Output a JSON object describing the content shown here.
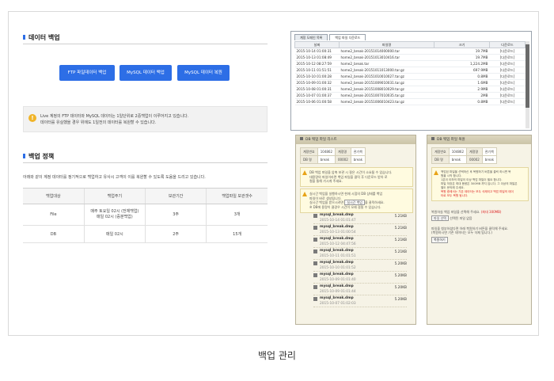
{
  "caption": "백업 관리",
  "left": {
    "section1_title": "데이터 백업",
    "buttons": [
      "FTP 파일데이터 백업",
      "MySQL 데이터 백업",
      "MySQL 데이터 복원"
    ],
    "notice_lines": [
      "Live 계정의 FTP 데이터와 MySQL 데이터는 1일단위로 2중백업이 이루어지고 있습니다.",
      "데이터를 유실했을 경우 위에도 1일전의 데이터를 복원할 수 있습니다."
    ],
    "section2_title": "백업 정책",
    "policy_desc": "아래와 같이 계정 데이터를 정기적으로 백업하고 유사시 고객이 이를 복원할 수 있도록 도움을 드리고 있습니다.",
    "policy_headers": [
      "백업대상",
      "백업주기",
      "보관기간",
      "백업파일 보관갯수"
    ],
    "policy_rows": [
      {
        "target": "File",
        "cycle1": "매주 토요일 02시 (전체백업)",
        "cycle2": "매일 02시 (증분백업)",
        "period": "3주",
        "count": "3개"
      },
      {
        "target": "DB",
        "cycle1": "매일 02시",
        "cycle2": "",
        "period": "2주",
        "count": "15개"
      }
    ]
  },
  "ss1": {
    "tabs": [
      "계정 도메인 목록",
      "백업 파일 다운로드"
    ],
    "headers": [
      "날짜",
      "파일명",
      "크기",
      "다운로드"
    ],
    "rows": [
      {
        "date": "2015-10-14 01:00:31",
        "name": "home2_break-20151014000000.tar",
        "size": "19.7MB",
        "dl": "[다운로드]"
      },
      {
        "date": "2015-10-13 01:08:49",
        "name": "home2_break-20151013010416.tar",
        "size": "19.7MB",
        "dl": "[다운로드]"
      },
      {
        "date": "2015-10-12 08:27:59",
        "name": "home2_break.tar",
        "size": "1,224.2MB",
        "dl": "[다운로드]"
      },
      {
        "date": "2015-10-11 01:51:51",
        "name": "home2_break-20151011013000.tar.gz",
        "size": "697.9MB",
        "dl": "[다운로드]"
      },
      {
        "date": "2015-10-10 01:00:28",
        "name": "home2_break-20151010010027.tar.gz",
        "size": "0.8MB",
        "dl": "[다운로드]"
      },
      {
        "date": "2015-10-09 01:00:32",
        "name": "home2_break-20151009010031.tar.gz",
        "size": "1.6MB",
        "dl": "[다운로드]"
      },
      {
        "date": "2015-10-08 01:00:31",
        "name": "home2_break-20151008010029.tar.gz",
        "size": "2.9MB",
        "dl": "[다운로드]"
      },
      {
        "date": "2015-10-07 01:00:37",
        "name": "home2_break-20151007010035.tar.gz",
        "size": "2MB",
        "dl": "[다운로드]"
      },
      {
        "date": "2015-10-06 01:00:58",
        "name": "home2_break-20151006010423.tar.gz",
        "size": "0.8MB",
        "dl": "[다운로드]"
      }
    ]
  },
  "ss2": {
    "title": "DB 백업 파일 리스트",
    "info": {
      "k1": "계정번호",
      "v1": "104862",
      "k2": "계정명",
      "v2": "관기책",
      "k3": "DB 명",
      "v3": "break",
      "k4": "파일명",
      "v4": "00002",
      "v5": "break"
    },
    "warn1": [
      "DB 백업 파일을 압축 보관 시 잘은 시간이 소요될 수 있습니다.",
      "대용량의 파일이라면 백업 파일을 클릭 후 다운로드 받아 로",
      "컬을 통해 가시게 주세요."
    ],
    "warn2": [
      "실시간 백업을 실행하시면 현재 시점의 DB 상태를 백업",
      "파일이 바로 생성됩니다.",
      "실시간 백업을 받으시려면",
      "실시간 백업",
      "을 클릭하세요.",
      "※ DB에 용량이 클경우 시간이 오래 걸릴 수 있습니다."
    ],
    "files": [
      {
        "name": "mysql_break.dmp",
        "date": "2015-10-14 01:01:47",
        "size": "5.21KB"
      },
      {
        "name": "mysql_break.dmp",
        "date": "2015-10-13 01:00:54",
        "size": "5.21KB"
      },
      {
        "name": "mysql_break.dmp",
        "date": "2015-10-12 04:47:56",
        "size": "5.21KB"
      },
      {
        "name": "mysql_break.dmp",
        "date": "2015-10-11 01:01:51",
        "size": "5.21KB"
      },
      {
        "name": "mysql_break.dmp",
        "date": "2015-10-10 01:01:52",
        "size": "5.20KB"
      },
      {
        "name": "mysql_break.dmp",
        "date": "2015-10-09 01:01:40",
        "size": "5.20KB"
      },
      {
        "name": "mysql_break.dmp",
        "date": "2015-10-09 01:01:44",
        "size": "5.20KB"
      },
      {
        "name": "mysql_break.dmp",
        "date": "2015-10-07 01:02:03",
        "size": "5.20KB"
      }
    ]
  },
  "ss3": {
    "title": "DB 백업 파일 복원",
    "info": {
      "k1": "계정번호",
      "v1": "104862",
      "k2": "계정명",
      "v2": "관기책",
      "k3": "DB 명",
      "v3": "break",
      "k4": "파일명",
      "v4": "00002",
      "v5": "break"
    },
    "warn": [
      "백업된 파일을 선택하신 후 복원하기 버튼을 클릭 하시면 복",
      "원을 시작 합니다.",
      "1분이 이하의 파일이 이상 백업 파일이 필요 합니다.",
      "파일 저장은 최대 용량은 300MB 까지 입니다. 그 이상의 파일은",
      "별도 문의해 주세요."
    ],
    "warn_red": [
      "복원 중에서는 기존 데이터는 모두 삭제되고 백업 파일의 데이",
      "터로 모두 복원 됩니다."
    ],
    "upload_label": "복원하실 백업 파일을 선택해 주세요.",
    "upload_max": "(최대 300MB)",
    "file_button": "파일 선택",
    "file_none": "선택된 파일 없음",
    "restore_hint1": "파일을 첨부하셨다면 아래 복원하기 버튼을 클릭해 주세요.",
    "restore_hint2": "(복원하시면 기존 데이터는 모두 삭제 됩니다.)",
    "restore_button": "복원하기"
  }
}
